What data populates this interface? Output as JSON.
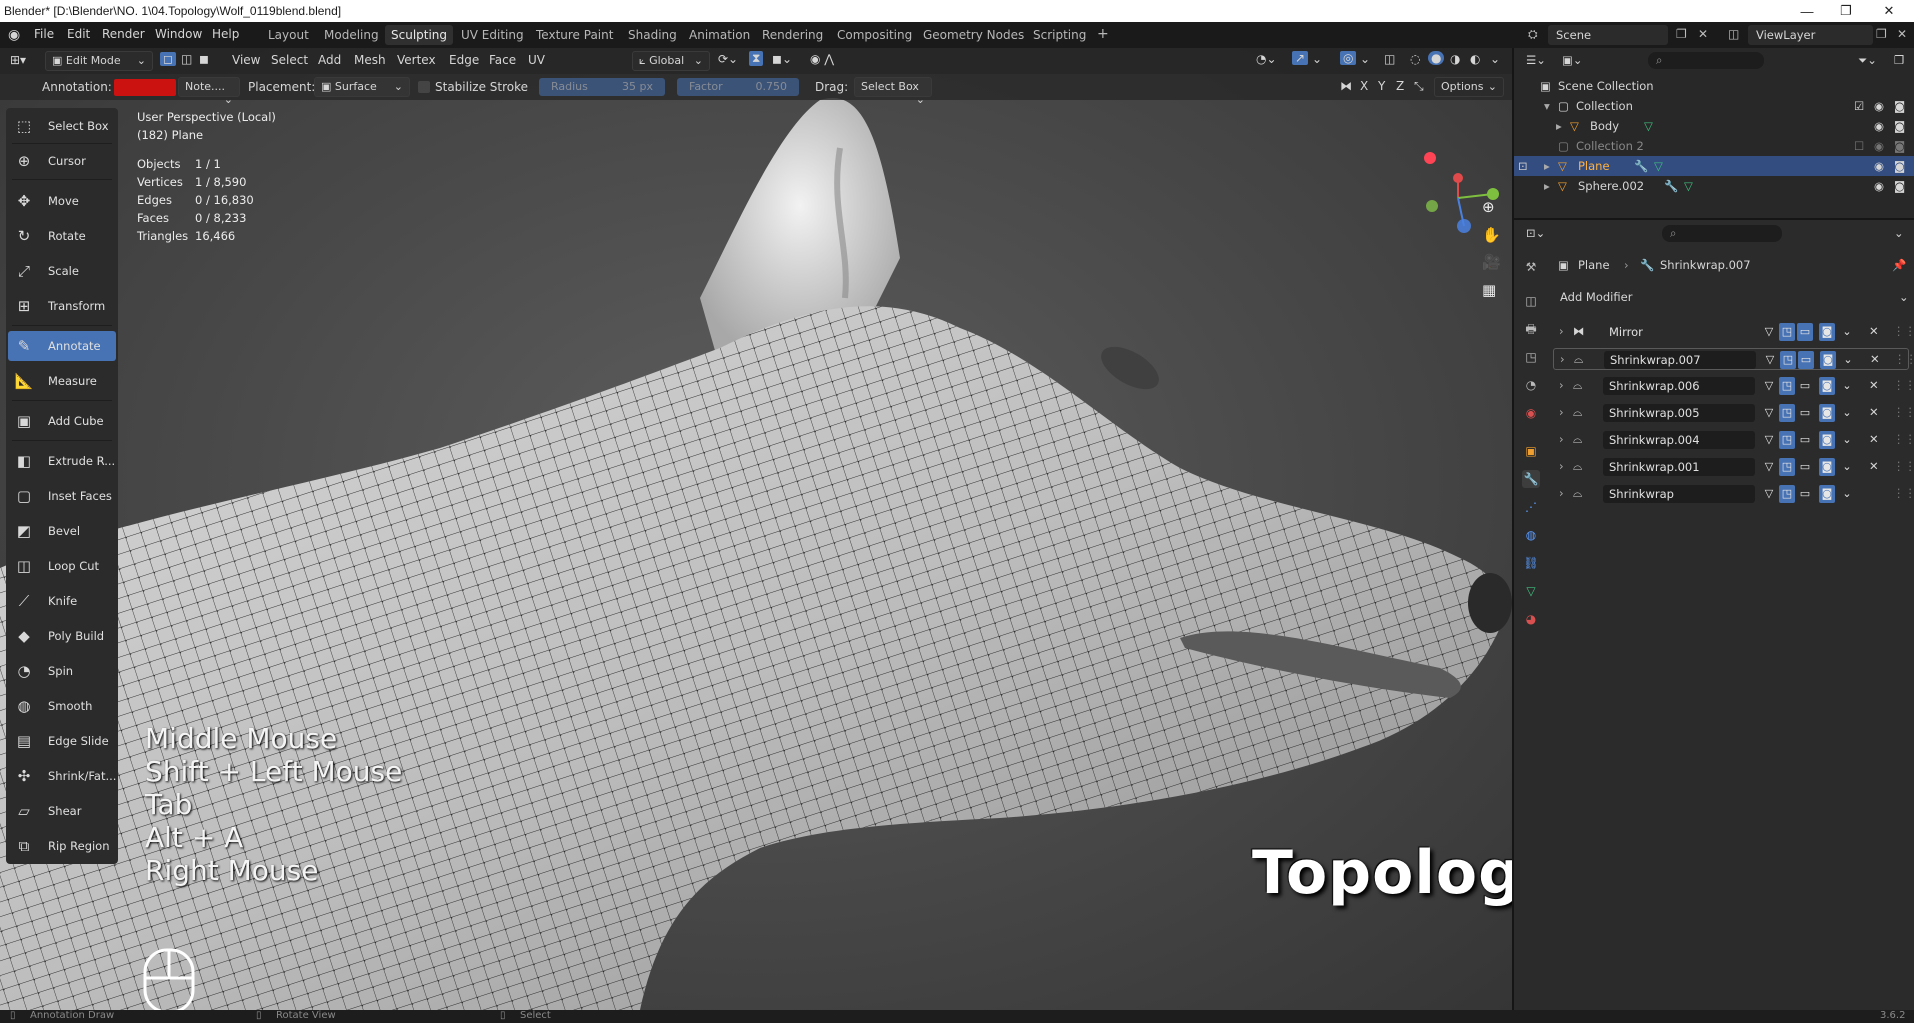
{
  "window": {
    "title": "Blender* [D:\\Blender\\NO. 1\\04.Topology\\Wolf_0119blend.blend]",
    "minimize": "—",
    "maximize": "❐",
    "close": "✕"
  },
  "menu": [
    "File",
    "Edit",
    "Render",
    "Window",
    "Help"
  ],
  "workspaces": [
    "Layout",
    "Modeling",
    "Sculpting",
    "UV Editing",
    "Texture Paint",
    "Shading",
    "Animation",
    "Rendering",
    "Compositing",
    "Geometry Nodes",
    "Scripting"
  ],
  "active_workspace": "Sculpting",
  "scene": {
    "label": "Scene",
    "view_layer": "ViewLayer"
  },
  "viewport_header": {
    "mode": "Edit Mode",
    "menus": [
      "View",
      "Select",
      "Add",
      "Mesh",
      "Vertex",
      "Edge",
      "Face",
      "UV"
    ],
    "orientation": "Global",
    "options": "Options"
  },
  "tool_settings": {
    "annotation_label": "Annotation:",
    "annotation_color": "#cc1111",
    "note": "Note....",
    "placement_label": "Placement:",
    "placement": "Surface",
    "stabilize": "Stabilize Stroke",
    "radius_label": "Radius",
    "radius_value": "35 px",
    "factor_label": "Factor",
    "factor_value": "0.750",
    "drag_label": "Drag:",
    "drag_value": "Select Box",
    "axes": [
      "X",
      "Y",
      "Z"
    ]
  },
  "toolbar": [
    {
      "label": "Select Box",
      "icon": "select-box-icon",
      "glyph": "⬚"
    },
    {
      "label": "Cursor",
      "icon": "cursor-icon",
      "glyph": "⊕"
    },
    {
      "label": "Move",
      "icon": "move-icon",
      "glyph": "✥"
    },
    {
      "label": "Rotate",
      "icon": "rotate-icon",
      "glyph": "↻"
    },
    {
      "label": "Scale",
      "icon": "scale-icon",
      "glyph": "⤢"
    },
    {
      "label": "Transform",
      "icon": "transform-icon",
      "glyph": "⊞"
    },
    {
      "label": "Annotate",
      "icon": "annotate-icon",
      "glyph": "✎"
    },
    {
      "label": "Measure",
      "icon": "measure-icon",
      "glyph": "📐"
    },
    {
      "label": "Add Cube",
      "icon": "add-cube-icon",
      "glyph": "▣"
    },
    {
      "label": "Extrude R...",
      "icon": "extrude-icon",
      "glyph": "◧"
    },
    {
      "label": "Inset Faces",
      "icon": "inset-faces-icon",
      "glyph": "▢"
    },
    {
      "label": "Bevel",
      "icon": "bevel-icon",
      "glyph": "◩"
    },
    {
      "label": "Loop Cut",
      "icon": "loop-cut-icon",
      "glyph": "◫"
    },
    {
      "label": "Knife",
      "icon": "knife-icon",
      "glyph": "⟋"
    },
    {
      "label": "Poly Build",
      "icon": "poly-build-icon",
      "glyph": "◆"
    },
    {
      "label": "Spin",
      "icon": "spin-icon",
      "glyph": "◔"
    },
    {
      "label": "Smooth",
      "icon": "smooth-icon",
      "glyph": "◍"
    },
    {
      "label": "Edge Slide",
      "icon": "edge-slide-icon",
      "glyph": "▤"
    },
    {
      "label": "Shrink/Fat...",
      "icon": "shrink-fatten-icon",
      "glyph": "✣"
    },
    {
      "label": "Shear",
      "icon": "shear-icon",
      "glyph": "▱"
    },
    {
      "label": "Rip Region",
      "icon": "rip-region-icon",
      "glyph": "⧉"
    }
  ],
  "active_tool": "Annotate",
  "viewport_info": {
    "perspective": "User Perspective (Local)",
    "object": "(182) Plane",
    "stats": [
      {
        "label": "Objects",
        "value": "1 / 1"
      },
      {
        "label": "Vertices",
        "value": "1 / 8,590"
      },
      {
        "label": "Edges",
        "value": "0 / 16,830"
      },
      {
        "label": "Faces",
        "value": "0 / 8,233"
      },
      {
        "label": "Triangles",
        "value": "16,466"
      }
    ]
  },
  "key_overlay": [
    "Middle Mouse",
    "Shift + Left Mouse",
    "Tab",
    "Alt + A",
    "Right Mouse"
  ],
  "overlay_title": "Topologize Model",
  "outliner": {
    "root": "Scene Collection",
    "items": [
      {
        "label": "Collection",
        "depth": 1
      },
      {
        "label": "Body",
        "depth": 2
      },
      {
        "label": "Collection 2",
        "depth": 1
      },
      {
        "label": "Plane",
        "depth": 1,
        "selected": true
      },
      {
        "label": "Sphere.002",
        "depth": 1
      }
    ]
  },
  "properties": {
    "breadcrumb_object": "Plane",
    "breadcrumb_modifier": "Shrinkwrap.007",
    "add_modifier": "Add Modifier",
    "modifiers": [
      {
        "name": "Mirror",
        "realtime": true
      },
      {
        "name": "Shrinkwrap.007",
        "realtime": true
      },
      {
        "name": "Shrinkwrap.006",
        "realtime": false
      },
      {
        "name": "Shrinkwrap.005",
        "realtime": false
      },
      {
        "name": "Shrinkwrap.004",
        "realtime": false
      },
      {
        "name": "Shrinkwrap.001",
        "realtime": false
      },
      {
        "name": "Shrinkwrap",
        "realtime": false
      }
    ]
  },
  "status": {
    "left": "Annotation Draw",
    "middle": "Rotate View",
    "right": "Select",
    "version": "3.6.2"
  },
  "colors": {
    "accent": "#4772b3",
    "header_bg": "#1a1a1a",
    "panel_bg": "#2b2b2b"
  }
}
